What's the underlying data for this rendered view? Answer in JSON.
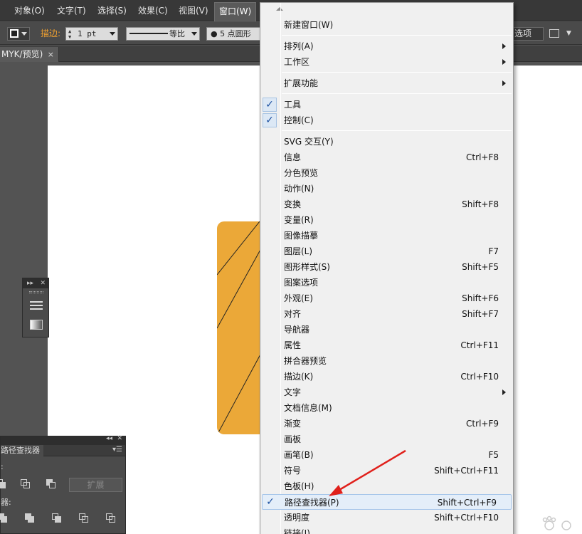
{
  "menubar": {
    "items": [
      {
        "label": "对象(O)"
      },
      {
        "label": "文字(T)"
      },
      {
        "label": "选择(S)"
      },
      {
        "label": "效果(C)"
      },
      {
        "label": "视图(V)"
      },
      {
        "label": "窗口(W)"
      }
    ]
  },
  "controlbar": {
    "stroke_label": "描边:",
    "stroke_weight": "1 pt",
    "profile_label": "等比",
    "brush_label": "● 5 点圆形",
    "options_label": "选项"
  },
  "tabbar": {
    "doc_tab": "MYK/预览)",
    "close": "×"
  },
  "pathfinder_panel": {
    "tab_label": "路径查找器",
    "shape_modes_label": ":",
    "pathfinders_label": "器:",
    "expand_label": "扩展"
  },
  "window_menu": {
    "items": [
      {
        "label": "新建窗口(W)",
        "shortcut": "",
        "submenu": false,
        "checked": false
      },
      {
        "label": "排列(A)",
        "shortcut": "",
        "submenu": true,
        "checked": false
      },
      {
        "label": "工作区",
        "shortcut": "",
        "submenu": true,
        "checked": false
      },
      {
        "label": "扩展功能",
        "shortcut": "",
        "submenu": true,
        "checked": false
      },
      {
        "label": "工具",
        "shortcut": "",
        "submenu": false,
        "checked": true
      },
      {
        "label": "控制(C)",
        "shortcut": "",
        "submenu": false,
        "checked": true
      },
      {
        "label": "SVG 交互(Y)",
        "shortcut": "",
        "submenu": false,
        "checked": false
      },
      {
        "label": "信息",
        "shortcut": "Ctrl+F8",
        "submenu": false,
        "checked": false
      },
      {
        "label": "分色预览",
        "shortcut": "",
        "submenu": false,
        "checked": false
      },
      {
        "label": "动作(N)",
        "shortcut": "",
        "submenu": false,
        "checked": false
      },
      {
        "label": "变换",
        "shortcut": "Shift+F8",
        "submenu": false,
        "checked": false
      },
      {
        "label": "变量(R)",
        "shortcut": "",
        "submenu": false,
        "checked": false
      },
      {
        "label": "图像描摹",
        "shortcut": "",
        "submenu": false,
        "checked": false
      },
      {
        "label": "图层(L)",
        "shortcut": "F7",
        "submenu": false,
        "checked": false
      },
      {
        "label": "图形样式(S)",
        "shortcut": "Shift+F5",
        "submenu": false,
        "checked": false
      },
      {
        "label": "图案选项",
        "shortcut": "",
        "submenu": false,
        "checked": false
      },
      {
        "label": "外观(E)",
        "shortcut": "Shift+F6",
        "submenu": false,
        "checked": false
      },
      {
        "label": "对齐",
        "shortcut": "Shift+F7",
        "submenu": false,
        "checked": false
      },
      {
        "label": "导航器",
        "shortcut": "",
        "submenu": false,
        "checked": false
      },
      {
        "label": "属性",
        "shortcut": "Ctrl+F11",
        "submenu": false,
        "checked": false
      },
      {
        "label": "拼合器预览",
        "shortcut": "",
        "submenu": false,
        "checked": false
      },
      {
        "label": "描边(K)",
        "shortcut": "Ctrl+F10",
        "submenu": false,
        "checked": false
      },
      {
        "label": "文字",
        "shortcut": "",
        "submenu": true,
        "checked": false
      },
      {
        "label": "文档信息(M)",
        "shortcut": "",
        "submenu": false,
        "checked": false
      },
      {
        "label": "渐变",
        "shortcut": "Ctrl+F9",
        "submenu": false,
        "checked": false
      },
      {
        "label": "画板",
        "shortcut": "",
        "submenu": false,
        "checked": false
      },
      {
        "label": "画笔(B)",
        "shortcut": "F5",
        "submenu": false,
        "checked": false
      },
      {
        "label": "符号",
        "shortcut": "Shift+Ctrl+F11",
        "submenu": false,
        "checked": false
      },
      {
        "label": "色板(H)",
        "shortcut": "",
        "submenu": false,
        "checked": false
      },
      {
        "label": "路径查找器(P)",
        "shortcut": "Shift+Ctrl+F9",
        "submenu": false,
        "checked": true,
        "highlighted": true
      },
      {
        "label": "透明度",
        "shortcut": "Shift+Ctrl+F10",
        "submenu": false,
        "checked": false
      },
      {
        "label": "链接(I)",
        "shortcut": "",
        "submenu": false,
        "checked": false
      }
    ],
    "check_glyph": "✓"
  },
  "colors": {
    "shape_fill": "#eba838",
    "annotation_arrow": "#e0201b"
  }
}
